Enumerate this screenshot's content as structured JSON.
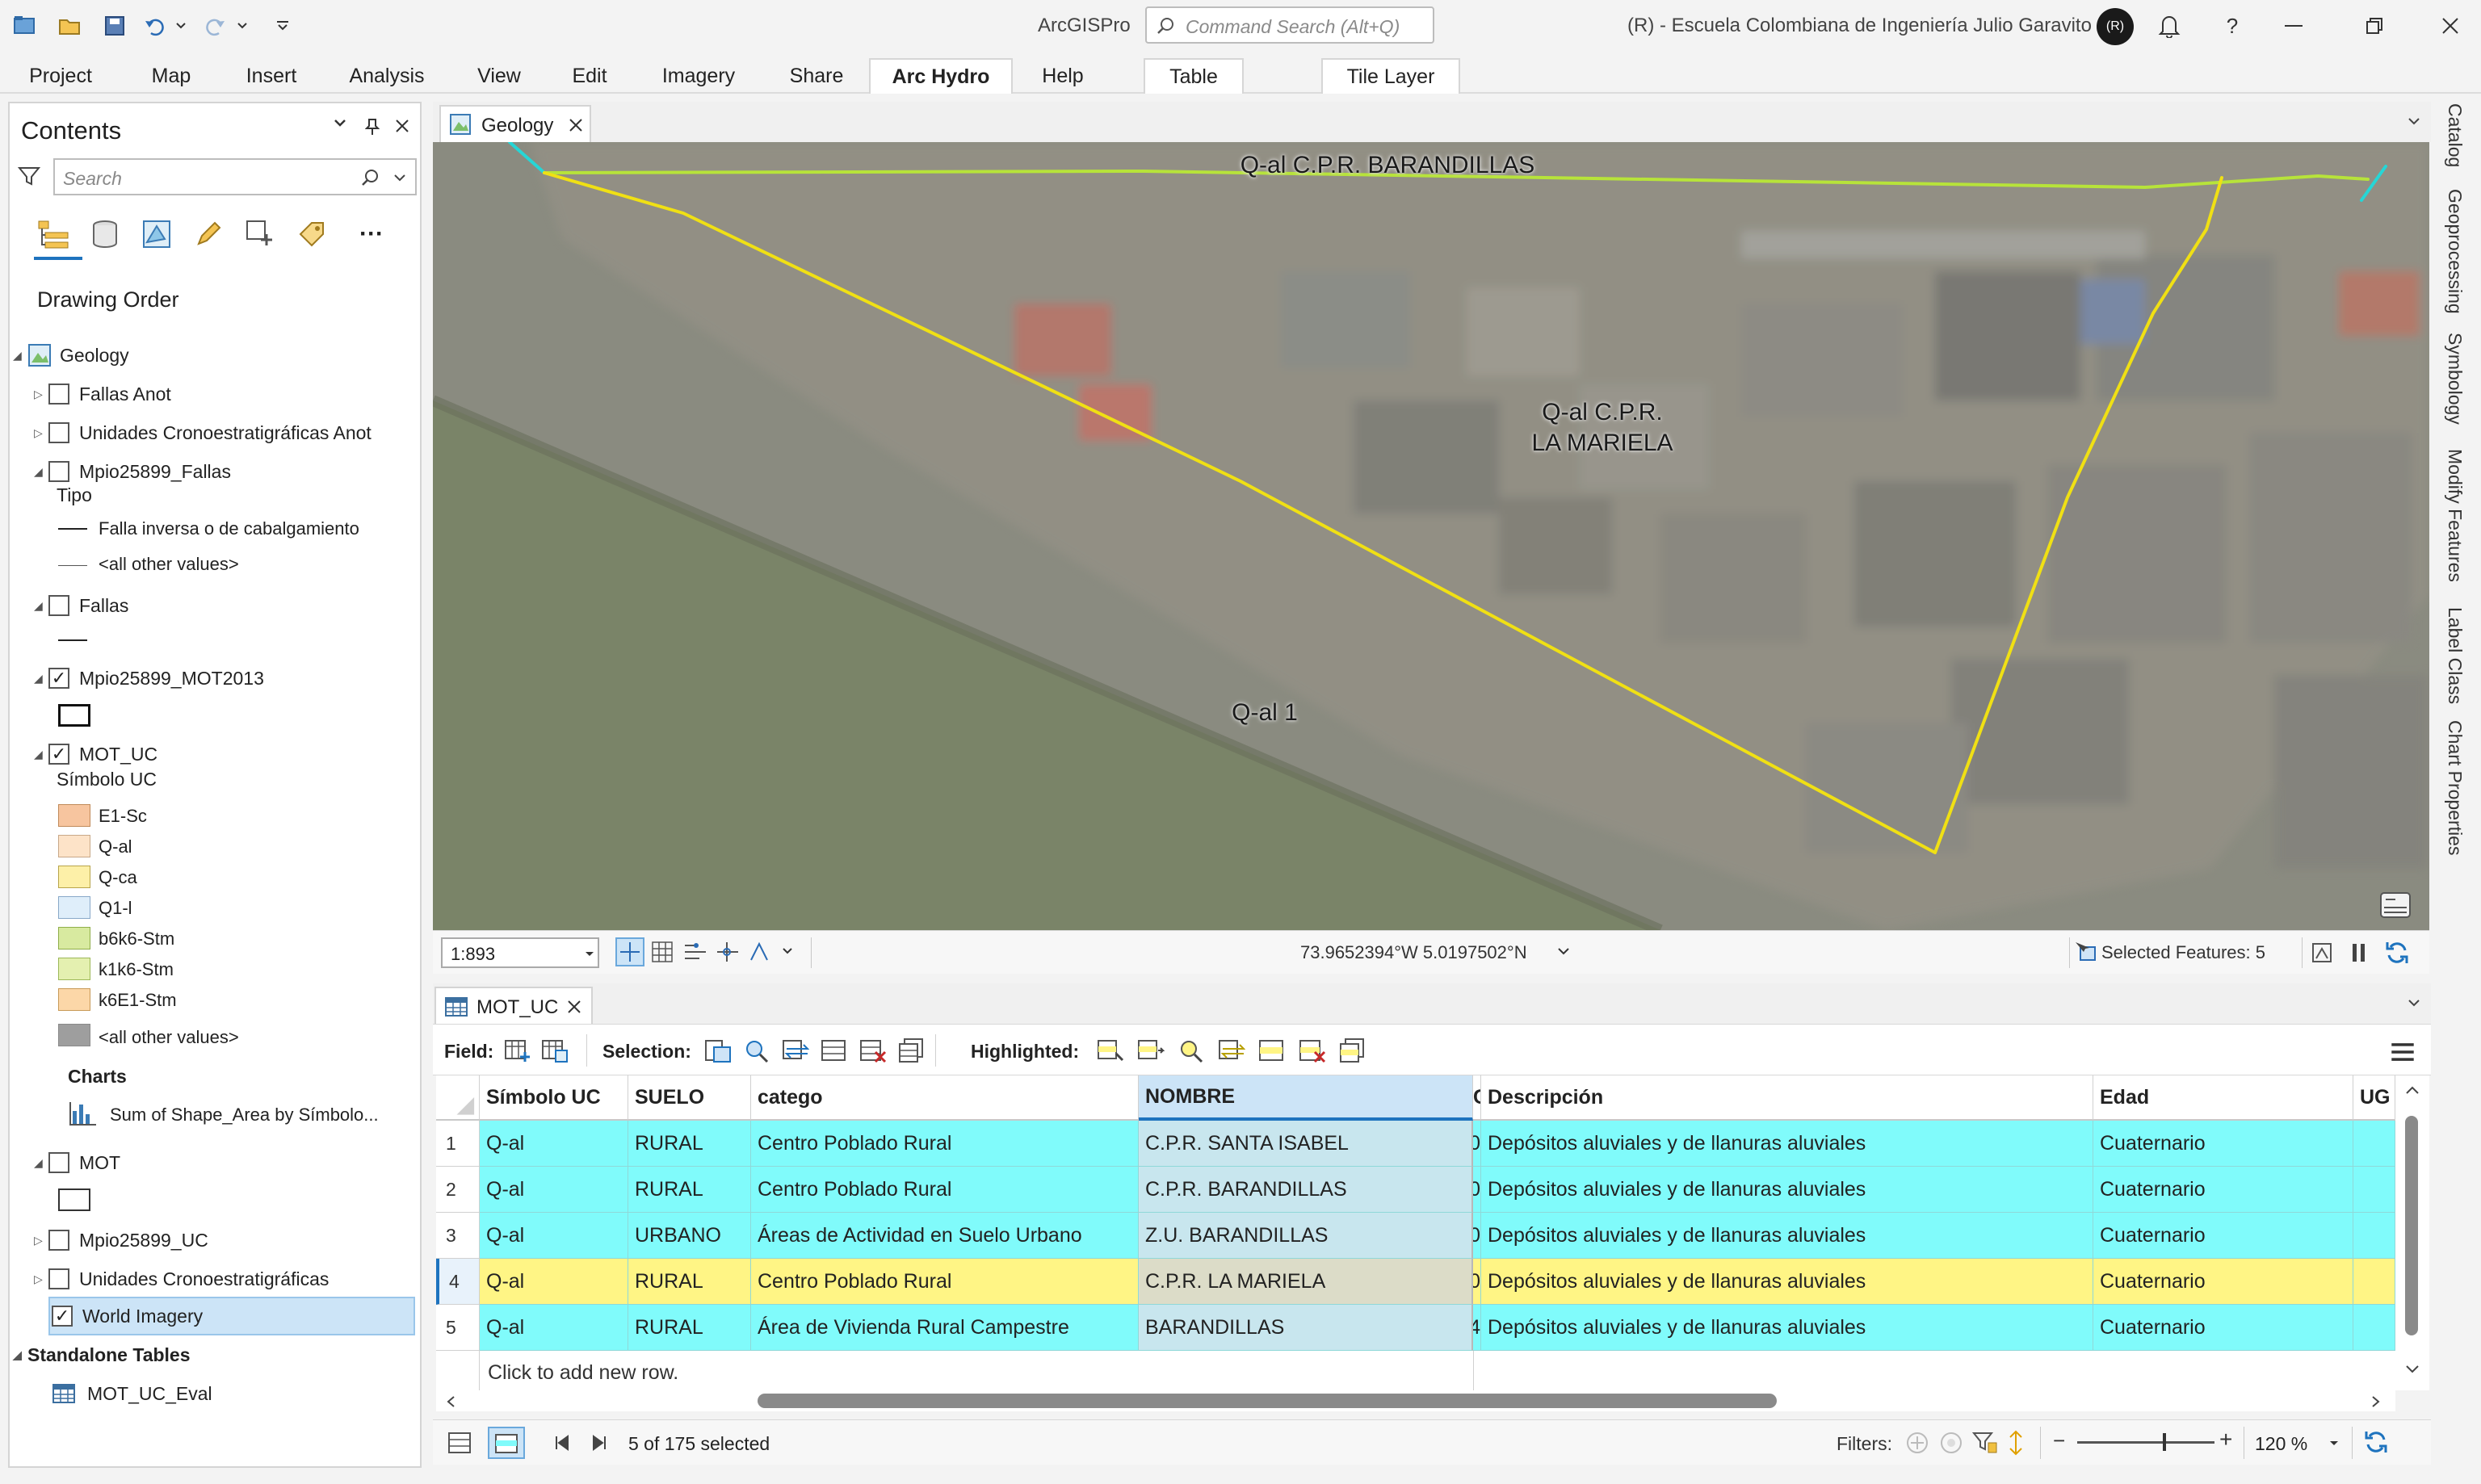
{
  "window": {
    "app_title": "ArcGISPro",
    "command_search_placeholder": "Command Search (Alt+Q)",
    "org": "(R) - Escuela Colombiana de Ingeniería Julio Garavito",
    "avatar_initials": "(R)"
  },
  "ribbon": {
    "tabs": [
      "Project",
      "Map",
      "Insert",
      "Analysis",
      "View",
      "Edit",
      "Imagery",
      "Share",
      "Arc Hydro",
      "Help",
      "Table",
      "Tile Layer"
    ],
    "active_tab": "Arc Hydro"
  },
  "contents": {
    "title": "Contents",
    "search_placeholder": "Search",
    "drawing_order": "Drawing Order",
    "map_name": "Geology",
    "layers": [
      {
        "name": "Fallas Anot",
        "checked": false
      },
      {
        "name": "Unidades Cronoestratigráficas Anot",
        "checked": false
      },
      {
        "name": "Mpio25899_Fallas",
        "checked": false,
        "field": "Tipo",
        "legend": [
          "Falla inversa o de cabalgamiento",
          "<all other values>"
        ]
      },
      {
        "name": "Fallas",
        "checked": false
      },
      {
        "name": "Mpio25899_MOT2013",
        "checked": true
      },
      {
        "name": "MOT_UC",
        "checked": true,
        "field": "Símbolo UC",
        "legend": [
          "E1-Sc",
          "Q-al",
          "Q-ca",
          "Q1-l",
          "b6k6-Stm",
          "k1k6-Stm",
          "k6E1-Stm",
          "<all other values>"
        ],
        "charts_label": "Charts",
        "chart_item": "Sum of Shape_Area by Símbolo..."
      },
      {
        "name": "MOT",
        "checked": false
      },
      {
        "name": "Mpio25899_UC",
        "checked": false
      },
      {
        "name": "Unidades Cronoestratigráficas",
        "checked": false
      },
      {
        "name": "World Imagery",
        "checked": true
      }
    ],
    "standalone_tables": "Standalone Tables",
    "table_item": "MOT_UC_Eval"
  },
  "legend_colors": {
    "E1-Sc": "#f7c59f",
    "Q-al": "#fde3c8",
    "Q-ca": "#fdf0a8",
    "Q1-l": "#dfeefa",
    "b6k6-Stm": "#d8eaa0",
    "k1k6-Stm": "#e4f0b0",
    "k6E1-Stm": "#fcd7a8",
    "other": "#9e9e9e"
  },
  "map": {
    "tab_name": "Geology",
    "labels": {
      "barandillas": "Q-al C.P.R. BARANDILLAS",
      "mariela_1": "Q-al C.P.R.",
      "mariela_2": "LA MARIELA",
      "qal1": "Q-al 1"
    },
    "scale": "1:893",
    "coordinates": "73.9652394°W 5.0197502°N",
    "selected_features": "Selected Features: 5"
  },
  "table": {
    "tab_name": "MOT_UC",
    "toolbar": {
      "field": "Field:",
      "selection": "Selection:",
      "highlighted": "Highlighted:"
    },
    "columns": [
      "Símbolo UC",
      "SUELO",
      "catego",
      "NOMBRE",
      "C",
      "Descripción",
      "Edad",
      "UG"
    ],
    "rows": [
      {
        "n": "1",
        "simbolo": "Q-al",
        "suelo": "RURAL",
        "catego": "Centro Poblado Rural",
        "nombre": "C.P.R. SANTA ISABEL",
        "c": "0",
        "descripcion": "Depósitos aluviales y de llanuras aluviales",
        "edad": "Cuaternario",
        "highlighted": false
      },
      {
        "n": "2",
        "simbolo": "Q-al",
        "suelo": "RURAL",
        "catego": "Centro Poblado Rural",
        "nombre": "C.P.R. BARANDILLAS",
        "c": "0",
        "descripcion": "Depósitos aluviales y de llanuras aluviales",
        "edad": "Cuaternario",
        "highlighted": false
      },
      {
        "n": "3",
        "simbolo": "Q-al",
        "suelo": "URBANO",
        "catego": "Áreas de Actividad en Suelo Urbano",
        "nombre": "Z.U. BARANDILLAS",
        "c": "0",
        "descripcion": "Depósitos aluviales y de llanuras aluviales",
        "edad": "Cuaternario",
        "highlighted": false
      },
      {
        "n": "4",
        "simbolo": "Q-al",
        "suelo": "RURAL",
        "catego": "Centro Poblado Rural",
        "nombre": "C.P.R. LA MARIELA",
        "c": "0",
        "descripcion": "Depósitos aluviales y de llanuras aluviales",
        "edad": "Cuaternario",
        "highlighted": true
      },
      {
        "n": "5",
        "simbolo": "Q-al",
        "suelo": "RURAL",
        "catego": "Área de Vivienda Rural Campestre",
        "nombre": "BARANDILLAS",
        "c": "4",
        "descripcion": "Depósitos aluviales y de llanuras aluviales",
        "edad": "Cuaternario",
        "highlighted": false
      }
    ],
    "add_row": "Click to add new row.",
    "selection_count": "5 of 175 selected",
    "filters": "Filters:",
    "zoom": "120 %",
    "selection_color": "#80fbfb",
    "highlight_color": "#fff585"
  },
  "side_dock": [
    "Catalog",
    "Geoprocessing",
    "Symbology",
    "Modify Features",
    "Label Class",
    "Chart Properties"
  ]
}
